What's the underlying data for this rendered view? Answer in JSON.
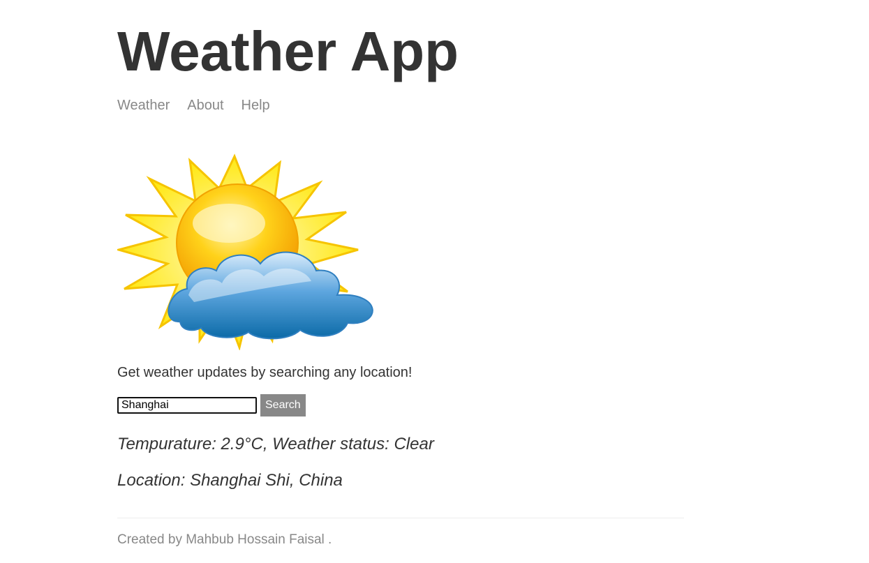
{
  "header": {
    "title": "Weather App",
    "nav": [
      {
        "label": "Weather"
      },
      {
        "label": "About"
      },
      {
        "label": "Help"
      }
    ]
  },
  "hero": {
    "image_icon": "sun-behind-cloud-icon"
  },
  "main": {
    "intro": "Get weather updates by searching any location!",
    "search": {
      "value": "Shanghai",
      "button_label": "Search"
    },
    "result": {
      "temperature_line": "Tempurature: 2.9°C, Weather status: Clear",
      "location_line": "Location: Shanghai Shi, China"
    }
  },
  "footer": {
    "text": "Created by Mahbub Hossain Faisal ."
  },
  "colors": {
    "text": "#333333",
    "muted": "#888888",
    "button_bg": "#888888",
    "sun": "#ffd200",
    "cloud": "#3a8fd0"
  }
}
